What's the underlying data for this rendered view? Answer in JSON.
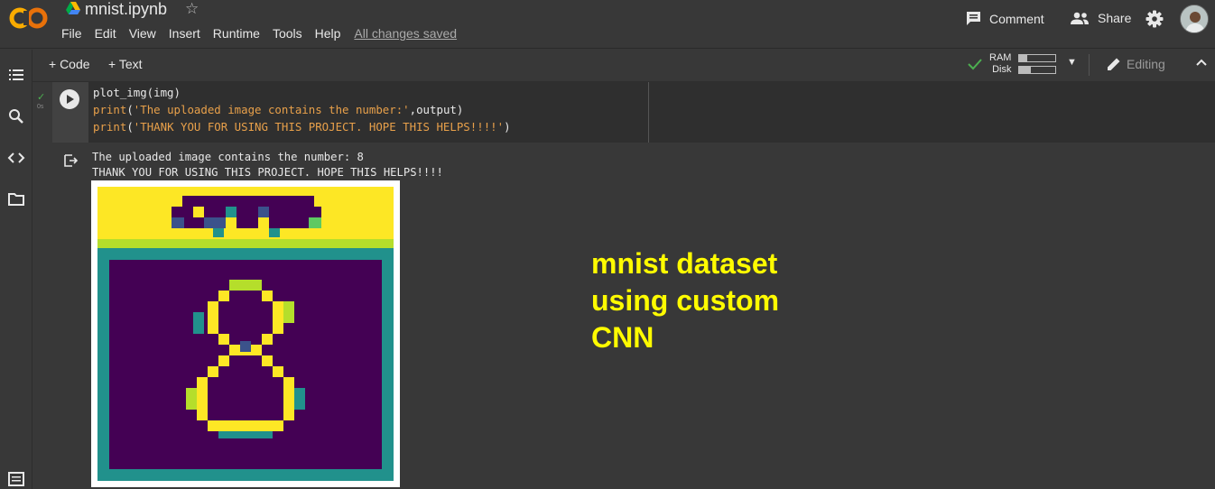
{
  "header": {
    "notebook_title": "mnist.ipynb",
    "menu": [
      "File",
      "Edit",
      "View",
      "Insert",
      "Runtime",
      "Tools",
      "Help"
    ],
    "save_status": "All changes saved",
    "comment_label": "Comment",
    "share_label": "Share"
  },
  "toolbar": {
    "add_code_label": "+ Code",
    "add_text_label": "+ Text",
    "ram_label": "RAM",
    "disk_label": "Disk",
    "ram_fraction": 0.22,
    "disk_fraction": 0.33,
    "editing_label": "Editing"
  },
  "cell": {
    "exec_time": "0s",
    "code_lines": [
      "plot_img(img)",
      "print('The uploaded image contains the number:',output)",
      "print('THANK YOU FOR USING THIS PROJECT. HOPE THIS HELPS!!!!')"
    ],
    "output_lines": [
      "The uploaded image contains the number: 8",
      "THANK YOU FOR USING THIS PROJECT. HOPE THIS HELPS!!!!"
    ]
  },
  "overlay_text": [
    "mnist dataset",
    "using custom",
    "CNN"
  ],
  "colors": {
    "background": "#383838",
    "accent_yellow": "#fffb00",
    "viridis_yellow": "#fde725",
    "viridis_teal": "#21918c",
    "viridis_purple": "#440154",
    "viridis_green": "#5ec962",
    "viridis_blue": "#3b528b"
  }
}
